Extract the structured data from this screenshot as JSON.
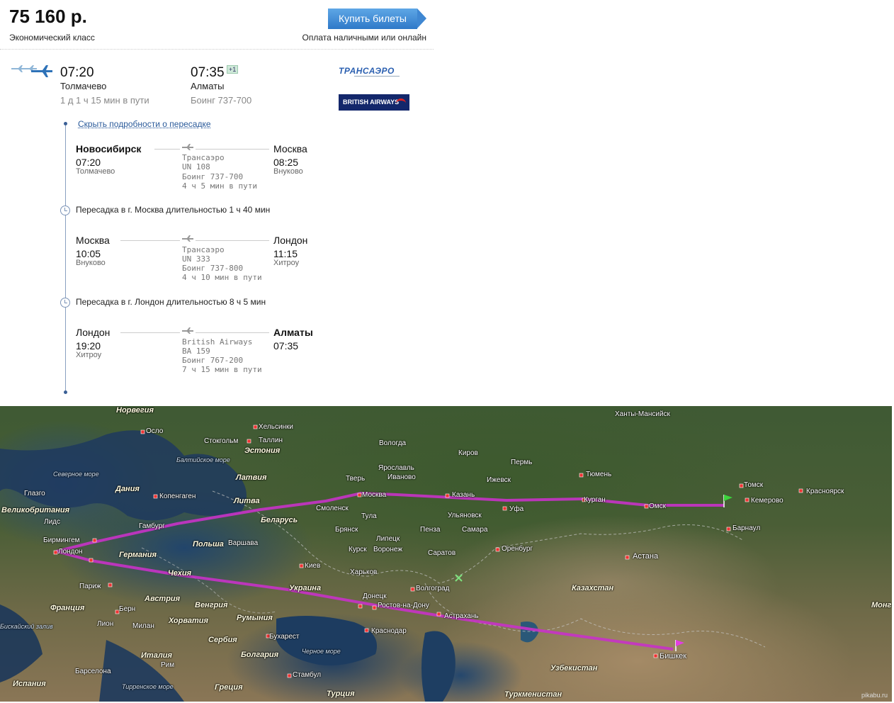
{
  "header": {
    "price": "75 160 р.",
    "class_label": "Экономический класс",
    "buy_button": "Купить билеты",
    "payment_label": "Оплата наличными или онлайн"
  },
  "summary": {
    "departure_time": "07:20",
    "departure_airport": "Толмачево",
    "duration": "1 д 1 ч 15 мин в пути",
    "arrival_time": "07:35",
    "arrival_plus_days": "+1",
    "arrival_city": "Алматы",
    "aircraft": "Боинг 737-700",
    "airline_logos": [
      "ТРАНСАЭРО",
      "BRITISH AIRWAYS"
    ]
  },
  "details": {
    "hide_link": "Скрыть подробности о пересадке",
    "segments": [
      {
        "from_city": "Новосибирск",
        "from_bold": true,
        "dep_time": "07:20",
        "from_airport": "Толмачево",
        "carrier": "Трансаэро",
        "flight": "UN 108",
        "aircraft": "Боинг 737-700",
        "duration": "4 ч 5 мин в пути",
        "to_city": "Москва",
        "to_bold": false,
        "arr_time": "08:25",
        "to_airport": "Внуково"
      },
      {
        "from_city": "Москва",
        "from_bold": false,
        "dep_time": "10:05",
        "from_airport": "Внуково",
        "carrier": "Трансаэро",
        "flight": "UN 333",
        "aircraft": "Боинг 737-800",
        "duration": "4 ч 10 мин в пути",
        "to_city": "Лондон",
        "to_bold": false,
        "arr_time": "11:15",
        "to_airport": "Хитроу"
      },
      {
        "from_city": "Лондон",
        "from_bold": false,
        "dep_time": "19:20",
        "from_airport": "Хитроу",
        "carrier": "British Airways",
        "flight": "BA 159",
        "aircraft": "Боинг 767-200",
        "duration": "7 ч 15 мин в пути",
        "to_city": "Алматы",
        "to_bold": true,
        "arr_time": "07:35",
        "to_airport": ""
      }
    ],
    "transfers": [
      "Пересадка в г. Москва длительностью 1 ч 40 мин",
      "Пересадка в г. Лондон длительностью 8 ч 5 мин"
    ]
  },
  "map": {
    "route_color": "#c832c8",
    "countries": [
      "Норвегия",
      "Эстония",
      "Латвия",
      "Литва",
      "Дания",
      "Великобритания",
      "Беларусь",
      "Германия",
      "Польша",
      "Чехия",
      "Украина",
      "Австрия",
      "Венгрия",
      "Франция",
      "Хорватия",
      "Румыния",
      "Сербия",
      "Италия",
      "Болгария",
      "Испания",
      "Греция",
      "Турция",
      "Казахстан",
      "Узбекистан",
      "Туркменистан",
      "Монг"
    ],
    "seas": [
      "Балтийское море",
      "Северное море",
      "Бискайский залив",
      "Черное море",
      "Тирренское море"
    ],
    "cities": [
      "Осло",
      "Хельсинки",
      "Стокгольм",
      "Таллин",
      "Глазго",
      "Копенгаген",
      "Лидс",
      "Бирмингем",
      "Лондон",
      "Гамбург",
      "Париж",
      "Берн",
      "Лион",
      "Милан",
      "Рим",
      "Барселона",
      "Варшава",
      "Киев",
      "Харьков",
      "Донецк",
      "Ростов-на-Дону",
      "Краснодар",
      "Бухарест",
      "Стамбул",
      "Москва",
      "Тверь",
      "Ярославль",
      "Иваново",
      "Смоленск",
      "Тула",
      "Брянск",
      "Курск",
      "Воронеж",
      "Липецк",
      "Пенза",
      "Саратов",
      "Волгоград",
      "Астрахань",
      "Вологда",
      "Киров",
      "Пермь",
      "Ижевск",
      "Казань",
      "Ульяновск",
      "Самара",
      "Уфа",
      "Оренбург",
      "Тюмень",
      "Курган",
      "Омск",
      "Ханты-Мансийск",
      "Томск",
      "Кемерово",
      "Красноярск",
      "Барнаул",
      "Астана",
      "Бишкек"
    ],
    "watermark": "pikabu.ru"
  }
}
